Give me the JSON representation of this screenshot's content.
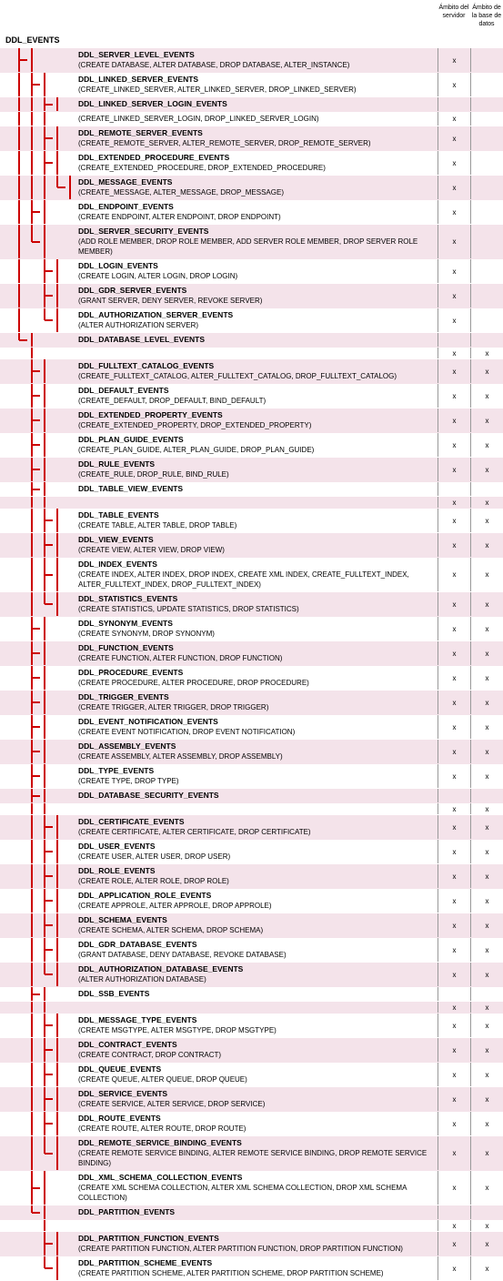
{
  "headers": {
    "c1": "Ámbito del servidor",
    "c2": "Ámbito de la base de datos"
  },
  "root": "DDL_EVENTS",
  "rows": [
    {
      "d": [
        0,
        0,
        0,
        0,
        0
      ],
      "br": [
        2,
        1,
        0,
        0,
        0
      ],
      "t": "DDL_SERVER_LEVEL_EVENTS",
      "s": "(CREATE DATABASE, ALTER DATABASE, DROP DATABASE, ALTER_INSTANCE)",
      "c1": "x",
      "c2": "",
      "alt": 1
    },
    {
      "d": [
        0,
        0,
        0,
        0,
        0
      ],
      "br": [
        1,
        2,
        1,
        0,
        0
      ],
      "t": "DDL_LINKED_SERVER_EVENTS",
      "s": "(CREATE_LINKED_SERVER, ALTER_LINKED_SERVER, DROP_LINKED_SERVER)",
      "c1": "x",
      "c2": ""
    },
    {
      "d": [
        0,
        0,
        0,
        0,
        0
      ],
      "br": [
        1,
        1,
        2,
        1,
        0
      ],
      "t": "DDL_LINKED_SERVER_LOGIN_EVENTS",
      "s": "",
      "c1": "",
      "c2": "",
      "alt": 1
    },
    {
      "d": [
        0,
        0,
        0,
        0,
        0
      ],
      "br": [
        1,
        1,
        1,
        0,
        0
      ],
      "t": "",
      "s": "(CREATE_LINKED_SERVER_LOGIN, DROP_LINKED_SERVER_LOGIN)",
      "c1": "x",
      "c2": ""
    },
    {
      "d": [
        0,
        0,
        0,
        0,
        0
      ],
      "br": [
        1,
        1,
        2,
        1,
        0
      ],
      "t": "DDL_REMOTE_SERVER_EVENTS",
      "s": "(CREATE_REMOTE_SERVER, ALTER_REMOTE_SERVER, DROP_REMOTE_SERVER)",
      "c1": "x",
      "c2": "",
      "alt": 1
    },
    {
      "d": [
        0,
        0,
        0,
        0,
        0
      ],
      "br": [
        1,
        1,
        2,
        1,
        0
      ],
      "t": "DDL_EXTENDED_PROCEDURE_EVENTS",
      "s": "(CREATE_EXTENDED_PROCEDURE, DROP_EXTENDED_PROCEDURE)",
      "c1": "x",
      "c2": ""
    },
    {
      "d": [
        0,
        0,
        0,
        0,
        0
      ],
      "br": [
        1,
        1,
        1,
        3,
        1
      ],
      "t": "DDL_MESSAGE_EVENTS",
      "s": "(CREATE_MESSAGE, ALTER_MESSAGE, DROP_MESSAGE)",
      "c1": "x",
      "c2": "",
      "alt": 1
    },
    {
      "d": [
        0,
        0,
        0,
        0,
        0
      ],
      "br": [
        1,
        2,
        1,
        0,
        0
      ],
      "t": "DDL_ENDPOINT_EVENTS",
      "s": "(CREATE ENDPOINT, ALTER ENDPOINT, DROP ENDPOINT)",
      "c1": "x",
      "c2": ""
    },
    {
      "d": [
        0,
        0,
        0,
        0,
        0
      ],
      "br": [
        1,
        3,
        1,
        0,
        0
      ],
      "t": "DDL_SERVER_SECURITY_EVENTS",
      "s": "(ADD ROLE MEMBER, DROP ROLE MEMBER, ADD SERVER ROLE MEMBER, DROP SERVER ROLE MEMBER)",
      "c1": "x",
      "c2": "",
      "alt": 1
    },
    {
      "d": [
        0,
        0,
        0,
        0,
        0
      ],
      "br": [
        1,
        0,
        2,
        1,
        0
      ],
      "t": "DDL_LOGIN_EVENTS",
      "s": "(CREATE LOGIN, ALTER LOGIN, DROP LOGIN)",
      "c1": "x",
      "c2": ""
    },
    {
      "d": [
        0,
        0,
        0,
        0,
        0
      ],
      "br": [
        1,
        0,
        2,
        1,
        0
      ],
      "t": "DDL_GDR_SERVER_EVENTS",
      "s": "(GRANT SERVER, DENY SERVER, REVOKE SERVER)",
      "c1": "x",
      "c2": "",
      "alt": 1
    },
    {
      "d": [
        0,
        0,
        0,
        0,
        0
      ],
      "br": [
        1,
        0,
        3,
        1,
        0
      ],
      "t": "DDL_AUTHORIZATION_SERVER_EVENTS",
      "s": "(ALTER AUTHORIZATION SERVER)",
      "c1": "x",
      "c2": ""
    },
    {
      "d": [
        0,
        0,
        0,
        0,
        0
      ],
      "br": [
        3,
        1,
        0,
        0,
        0
      ],
      "t": "DDL_DATABASE_LEVEL_EVENTS",
      "s": "",
      "c1": "",
      "c2": "",
      "alt": 1
    },
    {
      "d": [
        0,
        0,
        0,
        0,
        0
      ],
      "br": [
        0,
        1,
        0,
        0,
        0
      ],
      "t": "",
      "s": "",
      "c1": "x",
      "c2": "x"
    },
    {
      "d": [
        0,
        0,
        0,
        0,
        0
      ],
      "br": [
        0,
        2,
        1,
        0,
        0
      ],
      "t": "DDL_FULLTEXT_CATALOG_EVENTS",
      "s": "(CREATE_FULLTEXT_CATALOG, ALTER_FULLTEXT_CATALOG, DROP_FULLTEXT_CATALOG)",
      "c1": "x",
      "c2": "x",
      "alt": 1
    },
    {
      "d": [
        0,
        0,
        0,
        0,
        0
      ],
      "br": [
        0,
        2,
        1,
        0,
        0
      ],
      "t": "DDL_DEFAULT_EVENTS",
      "s": "(CREATE_DEFAULT, DROP_DEFAULT, BIND_DEFAULT)",
      "c1": "x",
      "c2": "x"
    },
    {
      "d": [
        0,
        0,
        0,
        0,
        0
      ],
      "br": [
        0,
        2,
        1,
        0,
        0
      ],
      "t": "DDL_EXTENDED_PROPERTY_EVENTS",
      "s": "(CREATE_EXTENDED_PROPERTY, DROP_EXTENDED_PROPERTY)",
      "c1": "x",
      "c2": "x",
      "alt": 1
    },
    {
      "d": [
        0,
        0,
        0,
        0,
        0
      ],
      "br": [
        0,
        2,
        1,
        0,
        0
      ],
      "t": "DDL_PLAN_GUIDE_EVENTS",
      "s": "(CREATE_PLAN_GUIDE, ALTER_PLAN_GUIDE, DROP_PLAN_GUIDE)",
      "c1": "x",
      "c2": "x"
    },
    {
      "d": [
        0,
        0,
        0,
        0,
        0
      ],
      "br": [
        0,
        2,
        1,
        0,
        0
      ],
      "t": "DDL_RULE_EVENTS",
      "s": "(CREATE_RULE, DROP_RULE, BIND_RULE)",
      "c1": "x",
      "c2": "x",
      "alt": 1
    },
    {
      "d": [
        0,
        0,
        0,
        0,
        0
      ],
      "br": [
        0,
        2,
        1,
        0,
        0
      ],
      "t": "DDL_TABLE_VIEW_EVENTS",
      "s": "",
      "c1": "",
      "c2": ""
    },
    {
      "d": [
        0,
        0,
        0,
        0,
        0
      ],
      "br": [
        0,
        1,
        1,
        0,
        0
      ],
      "t": "",
      "s": "",
      "c1": "x",
      "c2": "x",
      "alt": 1
    },
    {
      "d": [
        0,
        0,
        0,
        0,
        0
      ],
      "br": [
        0,
        1,
        2,
        1,
        0
      ],
      "t": "DDL_TABLE_EVENTS",
      "s": "(CREATE TABLE, ALTER TABLE, DROP TABLE)",
      "c1": "x",
      "c2": "x"
    },
    {
      "d": [
        0,
        0,
        0,
        0,
        0
      ],
      "br": [
        0,
        1,
        2,
        1,
        0
      ],
      "t": "DDL_VIEW_EVENTS",
      "s": "(CREATE VIEW, ALTER VIEW, DROP VIEW)",
      "c1": "x",
      "c2": "x",
      "alt": 1
    },
    {
      "d": [
        0,
        0,
        0,
        0,
        0
      ],
      "br": [
        0,
        1,
        2,
        1,
        0
      ],
      "t": "DDL_INDEX_EVENTS",
      "s": "(CREATE INDEX, ALTER INDEX, DROP INDEX, CREATE XML INDEX, CREATE_FULLTEXT_INDEX, ALTER_FULLTEXT_INDEX, DROP_FULLTEXT_INDEX)",
      "c1": "x",
      "c2": "x"
    },
    {
      "d": [
        0,
        0,
        0,
        0,
        0
      ],
      "br": [
        0,
        1,
        3,
        1,
        0
      ],
      "t": "DDL_STATISTICS_EVENTS",
      "s": "(CREATE STATISTICS, UPDATE STATISTICS, DROP STATISTICS)",
      "c1": "x",
      "c2": "x",
      "alt": 1
    },
    {
      "d": [
        0,
        0,
        0,
        0,
        0
      ],
      "br": [
        0,
        2,
        1,
        0,
        0
      ],
      "t": "DDL_SYNONYM_EVENTS",
      "s": "(CREATE SYNONYM, DROP SYNONYM)",
      "c1": "x",
      "c2": "x"
    },
    {
      "d": [
        0,
        0,
        0,
        0,
        0
      ],
      "br": [
        0,
        2,
        1,
        0,
        0
      ],
      "t": "DDL_FUNCTION_EVENTS",
      "s": "(CREATE FUNCTION, ALTER FUNCTION, DROP FUNCTION)",
      "c1": "x",
      "c2": "x",
      "alt": 1
    },
    {
      "d": [
        0,
        0,
        0,
        0,
        0
      ],
      "br": [
        0,
        2,
        1,
        0,
        0
      ],
      "t": "DDL_PROCEDURE_EVENTS",
      "s": "(CREATE PROCEDURE, ALTER PROCEDURE, DROP PROCEDURE)",
      "c1": "x",
      "c2": "x"
    },
    {
      "d": [
        0,
        0,
        0,
        0,
        0
      ],
      "br": [
        0,
        2,
        1,
        0,
        0
      ],
      "t": "DDL_TRIGGER_EVENTS",
      "s": "(CREATE TRIGGER, ALTER TRIGGER, DROP TRIGGER)",
      "c1": "x",
      "c2": "x",
      "alt": 1
    },
    {
      "d": [
        0,
        0,
        0,
        0,
        0
      ],
      "br": [
        0,
        2,
        1,
        0,
        0
      ],
      "t": "DDL_EVENT_NOTIFICATION_EVENTS",
      "s": "(CREATE EVENT NOTIFICATION, DROP EVENT NOTIFICATION)",
      "c1": "x",
      "c2": "x"
    },
    {
      "d": [
        0,
        0,
        0,
        0,
        0
      ],
      "br": [
        0,
        2,
        1,
        0,
        0
      ],
      "t": "DDL_ASSEMBLY_EVENTS",
      "s": "(CREATE ASSEMBLY, ALTER ASSEMBLY, DROP ASSEMBLY)",
      "c1": "x",
      "c2": "x",
      "alt": 1
    },
    {
      "d": [
        0,
        0,
        0,
        0,
        0
      ],
      "br": [
        0,
        2,
        1,
        0,
        0
      ],
      "t": "DDL_TYPE_EVENTS",
      "s": "(CREATE TYPE, DROP TYPE)",
      "c1": "x",
      "c2": "x"
    },
    {
      "d": [
        0,
        0,
        0,
        0,
        0
      ],
      "br": [
        0,
        2,
        1,
        0,
        0
      ],
      "t": "DDL_DATABASE_SECURITY_EVENTS",
      "s": "",
      "c1": "",
      "c2": "",
      "alt": 1
    },
    {
      "d": [
        0,
        0,
        0,
        0,
        0
      ],
      "br": [
        0,
        1,
        1,
        0,
        0
      ],
      "t": "",
      "s": "",
      "c1": "x",
      "c2": "x"
    },
    {
      "d": [
        0,
        0,
        0,
        0,
        0
      ],
      "br": [
        0,
        1,
        2,
        1,
        0
      ],
      "t": "DDL_CERTIFICATE_EVENTS",
      "s": "(CREATE CERTIFICATE, ALTER CERTIFICATE, DROP CERTIFICATE)",
      "c1": "x",
      "c2": "x",
      "alt": 1
    },
    {
      "d": [
        0,
        0,
        0,
        0,
        0
      ],
      "br": [
        0,
        1,
        2,
        1,
        0
      ],
      "t": "DDL_USER_EVENTS",
      "s": "(CREATE USER, ALTER USER, DROP USER)",
      "c1": "x",
      "c2": "x"
    },
    {
      "d": [
        0,
        0,
        0,
        0,
        0
      ],
      "br": [
        0,
        1,
        2,
        1,
        0
      ],
      "t": "DDL_ROLE_EVENTS",
      "s": "(CREATE ROLE, ALTER ROLE, DROP ROLE)",
      "c1": "x",
      "c2": "x",
      "alt": 1
    },
    {
      "d": [
        0,
        0,
        0,
        0,
        0
      ],
      "br": [
        0,
        1,
        2,
        1,
        0
      ],
      "t": "DDL_APPLICATION_ROLE_EVENTS",
      "s": "(CREATE APPROLE, ALTER APPROLE, DROP APPROLE)",
      "c1": "x",
      "c2": "x"
    },
    {
      "d": [
        0,
        0,
        0,
        0,
        0
      ],
      "br": [
        0,
        1,
        2,
        1,
        0
      ],
      "t": "DDL_SCHEMA_EVENTS",
      "s": "(CREATE SCHEMA, ALTER SCHEMA, DROP SCHEMA)",
      "c1": "x",
      "c2": "x",
      "alt": 1
    },
    {
      "d": [
        0,
        0,
        0,
        0,
        0
      ],
      "br": [
        0,
        1,
        2,
        1,
        0
      ],
      "t": "DDL_GDR_DATABASE_EVENTS",
      "s": "(GRANT DATABASE, DENY DATABASE, REVOKE DATABASE)",
      "c1": "x",
      "c2": "x"
    },
    {
      "d": [
        0,
        0,
        0,
        0,
        0
      ],
      "br": [
        0,
        1,
        3,
        1,
        0
      ],
      "t": "DDL_AUTHORIZATION_DATABASE_EVENTS",
      "s": "(ALTER AUTHORIZATION DATABASE)",
      "c1": "x",
      "c2": "x",
      "alt": 1
    },
    {
      "d": [
        0,
        0,
        0,
        0,
        0
      ],
      "br": [
        0,
        2,
        1,
        0,
        0
      ],
      "t": "DDL_SSB_EVENTS",
      "s": "",
      "c1": "",
      "c2": ""
    },
    {
      "d": [
        0,
        0,
        0,
        0,
        0
      ],
      "br": [
        0,
        1,
        1,
        0,
        0
      ],
      "t": "",
      "s": "",
      "c1": "x",
      "c2": "x",
      "alt": 1
    },
    {
      "d": [
        0,
        0,
        0,
        0,
        0
      ],
      "br": [
        0,
        1,
        2,
        1,
        0
      ],
      "t": "DDL_MESSAGE_TYPE_EVENTS",
      "s": "(CREATE MSGTYPE, ALTER MSGTYPE, DROP MSGTYPE)",
      "c1": "x",
      "c2": "x"
    },
    {
      "d": [
        0,
        0,
        0,
        0,
        0
      ],
      "br": [
        0,
        1,
        2,
        1,
        0
      ],
      "t": "DDL_CONTRACT_EVENTS",
      "s": "(CREATE CONTRACT, DROP CONTRACT)",
      "c1": "x",
      "c2": "x",
      "alt": 1
    },
    {
      "d": [
        0,
        0,
        0,
        0,
        0
      ],
      "br": [
        0,
        1,
        2,
        1,
        0
      ],
      "t": "DDL_QUEUE_EVENTS",
      "s": "(CREATE QUEUE, ALTER QUEUE, DROP QUEUE)",
      "c1": "x",
      "c2": "x"
    },
    {
      "d": [
        0,
        0,
        0,
        0,
        0
      ],
      "br": [
        0,
        1,
        2,
        1,
        0
      ],
      "t": "DDL_SERVICE_EVENTS",
      "s": "(CREATE SERVICE, ALTER SERVICE, DROP SERVICE)",
      "c1": "x",
      "c2": "x",
      "alt": 1
    },
    {
      "d": [
        0,
        0,
        0,
        0,
        0
      ],
      "br": [
        0,
        1,
        2,
        1,
        0
      ],
      "t": "DDL_ROUTE_EVENTS",
      "s": "(CREATE ROUTE, ALTER ROUTE, DROP ROUTE)",
      "c1": "x",
      "c2": "x"
    },
    {
      "d": [
        0,
        0,
        0,
        0,
        0
      ],
      "br": [
        0,
        1,
        3,
        1,
        0
      ],
      "t": "DDL_REMOTE_SERVICE_BINDING_EVENTS",
      "s": "(CREATE REMOTE SERVICE BINDING, ALTER REMOTE SERVICE BINDING, DROP REMOTE SERVICE BINDING)",
      "c1": "x",
      "c2": "x",
      "alt": 1
    },
    {
      "d": [
        0,
        0,
        0,
        0,
        0
      ],
      "br": [
        0,
        2,
        1,
        0,
        0
      ],
      "t": "DDL_XML_SCHEMA_COLLECTION_EVENTS",
      "s": "(CREATE XML SCHEMA COLLECTION, ALTER XML SCHEMA COLLECTION, DROP XML SCHEMA COLLECTION)",
      "c1": "x",
      "c2": "x"
    },
    {
      "d": [
        0,
        0,
        0,
        0,
        0
      ],
      "br": [
        0,
        3,
        1,
        0,
        0
      ],
      "t": "DDL_PARTITION_EVENTS",
      "s": "",
      "c1": "",
      "c2": "",
      "alt": 1
    },
    {
      "d": [
        0,
        0,
        0,
        0,
        0
      ],
      "br": [
        0,
        0,
        1,
        0,
        0
      ],
      "t": "",
      "s": "",
      "c1": "x",
      "c2": "x"
    },
    {
      "d": [
        0,
        0,
        0,
        0,
        0
      ],
      "br": [
        0,
        0,
        2,
        1,
        0
      ],
      "t": "DDL_PARTITION_FUNCTION_EVENTS",
      "s": "(CREATE PARTITION FUNCTION, ALTER PARTITION FUNCTION, DROP PARTITION FUNCTION)",
      "c1": "x",
      "c2": "x",
      "alt": 1
    },
    {
      "d": [
        0,
        0,
        0,
        0,
        0
      ],
      "br": [
        0,
        0,
        3,
        1,
        0
      ],
      "t": "DDL_PARTITION_SCHEME_EVENTS",
      "s": "(CREATE PARTITION SCHEME, ALTER PARTITION SCHEME, DROP PARTITION SCHEME)",
      "c1": "x",
      "c2": "x"
    }
  ]
}
